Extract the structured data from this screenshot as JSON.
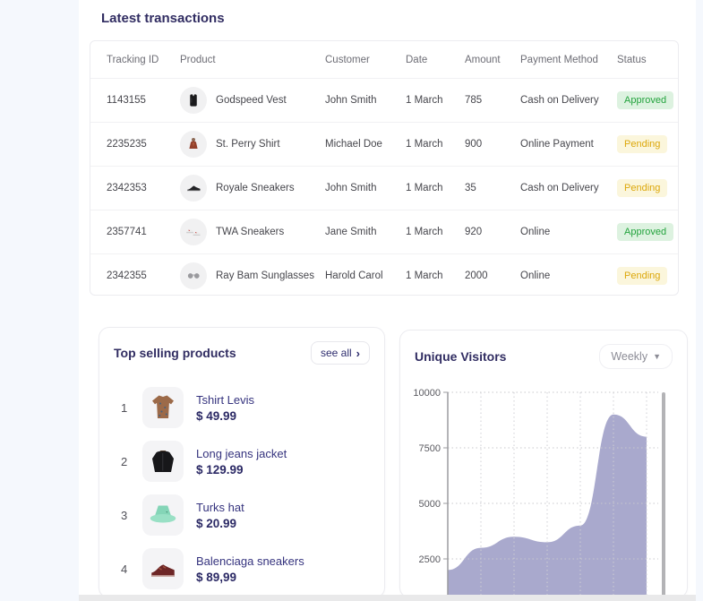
{
  "transactions": {
    "title": "Latest transactions",
    "columns": {
      "tracking_id": "Tracking ID",
      "product": "Product",
      "customer": "Customer",
      "date": "Date",
      "amount": "Amount",
      "payment_method": "Payment Method",
      "status": "Status"
    },
    "rows": [
      {
        "tracking_id": "1143155",
        "product": "Godspeed Vest",
        "customer": "John Smith",
        "date": "1 March",
        "amount": "785",
        "payment_method": "Cash on Delivery",
        "status": "Approved"
      },
      {
        "tracking_id": "2235235",
        "product": "St. Perry Shirt",
        "customer": "Michael Doe",
        "date": "1 March",
        "amount": "900",
        "payment_method": "Online Payment",
        "status": "Pending"
      },
      {
        "tracking_id": "2342353",
        "product": "Royale Sneakers",
        "customer": "John Smith",
        "date": "1 March",
        "amount": "35",
        "payment_method": "Cash on Delivery",
        "status": "Pending"
      },
      {
        "tracking_id": "2357741",
        "product": "TWA Sneakers",
        "customer": "Jane Smith",
        "date": "1 March",
        "amount": "920",
        "payment_method": "Online",
        "status": "Approved"
      },
      {
        "tracking_id": "2342355",
        "product": "Ray Bam Sunglasses",
        "customer": "Harold Carol",
        "date": "1 March",
        "amount": "2000",
        "payment_method": "Online",
        "status": "Pending"
      }
    ],
    "status_colors": {
      "approved": {
        "bg": "#ddf2e0",
        "text": "#23a33d"
      },
      "pending": {
        "bg": "#fbf6dc",
        "text": "#dca70a"
      }
    }
  },
  "top_selling": {
    "title": "Top selling products",
    "see_all_label": "see all",
    "see_all_chevron": "›",
    "items": [
      {
        "rank": "1",
        "name": "Tshirt Levis",
        "price": "$ 49.99"
      },
      {
        "rank": "2",
        "name": "Long jeans jacket",
        "price": "$ 129.99"
      },
      {
        "rank": "3",
        "name": "Turks hat",
        "price": "$ 20.99"
      },
      {
        "rank": "4",
        "name": "Balenciaga sneakers",
        "price": "$ 89,99"
      }
    ]
  },
  "unique_visitors": {
    "title": "Unique Visitors",
    "period_label": "Weekly",
    "chart_data": {
      "type": "area",
      "x": [
        "1",
        "2",
        "3",
        "4",
        "5",
        "6",
        "7"
      ],
      "values": [
        2000,
        3000,
        3500,
        3250,
        4000,
        9000,
        8000
      ],
      "title": "Unique Visitors",
      "xlabel": "",
      "ylabel": "",
      "y_ticks": [
        10000,
        7500,
        5000,
        2500
      ],
      "ylim": [
        0,
        10000
      ],
      "grid": "dotted",
      "legend": "none",
      "fill_color": "#a9a9cd",
      "axis_color": "#9b9b9f",
      "tick_label_color": "#5a5a60"
    }
  }
}
